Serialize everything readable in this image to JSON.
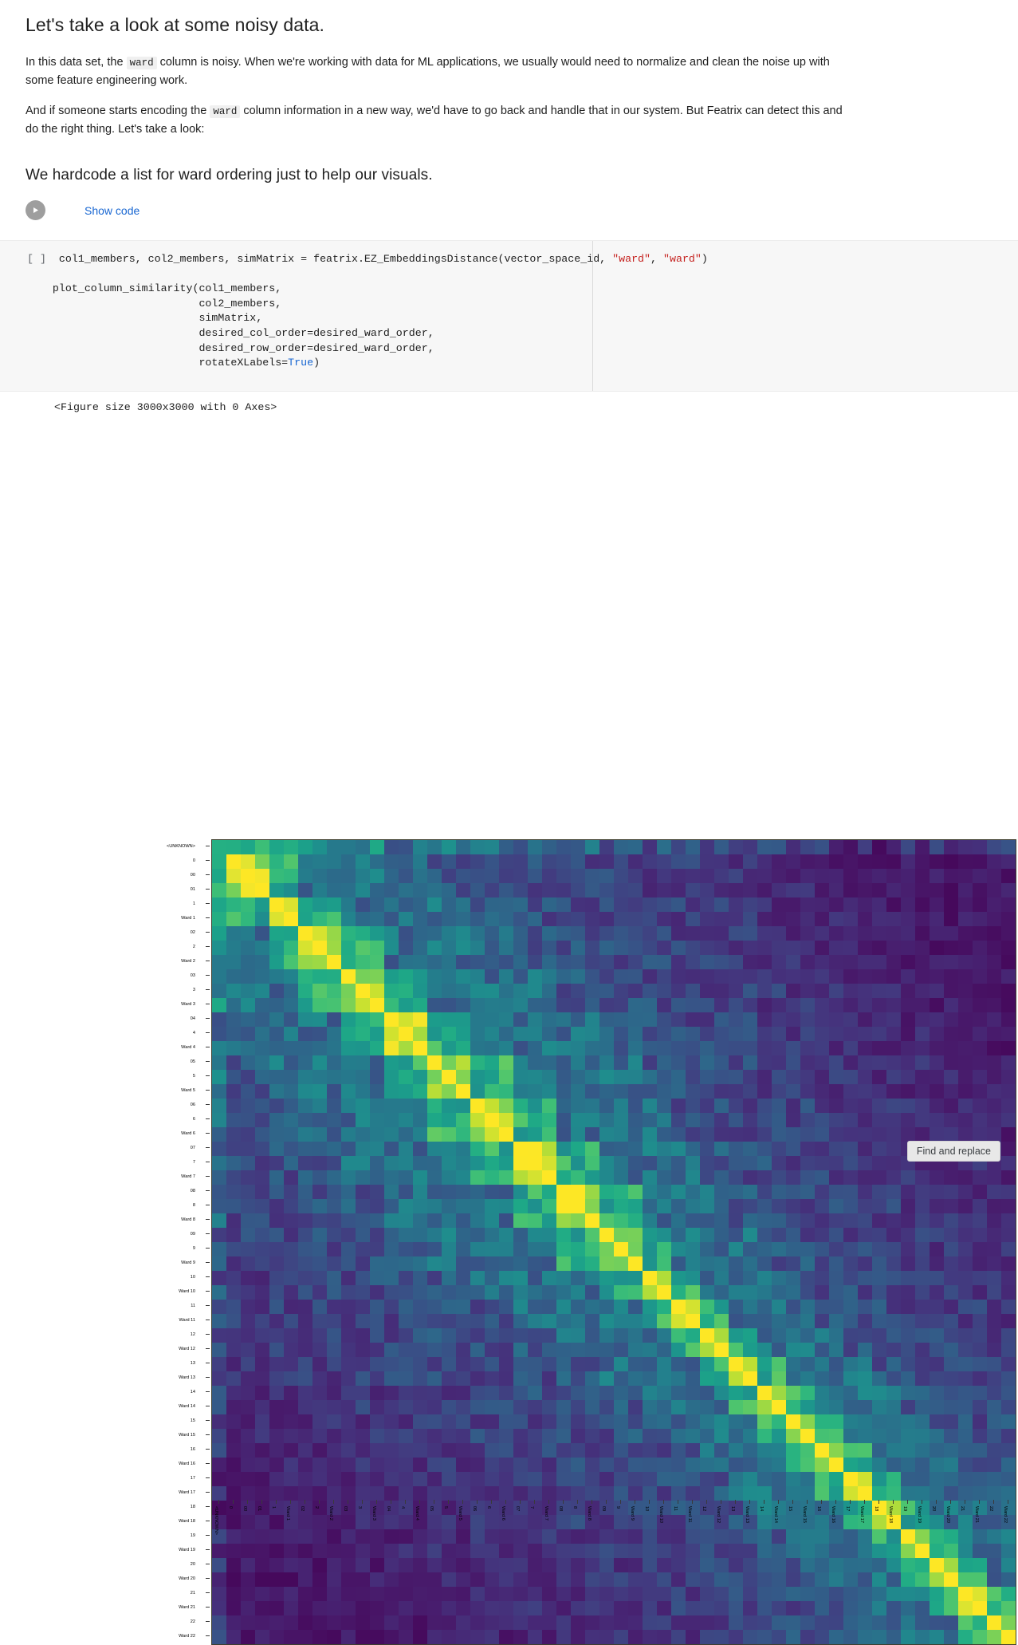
{
  "notebook": {
    "title": "Let's take a look at some noisy data.",
    "paragraph1_part1": "In this data set, the ",
    "paragraph1_code": "ward",
    "paragraph1_part2": " column is noisy. When we're working with data for ML applications, we usually would need to normalize and clean the noise up with some feature engineering work.",
    "paragraph2_part1": "And if someone starts encoding the ",
    "paragraph2_code": "ward",
    "paragraph2_part2": " column information in a new way, we'd have to go back and handle that in our system. But Featrix can detect this and do the right thing. Let's take a look:",
    "subtitle": "We hardcode a list for ward ordering just to help our visuals.",
    "show_code_label": "Show code",
    "play_icon": "play-icon"
  },
  "code_cell": {
    "prompt": "[ ]",
    "line1_pre": "col1_members, col2_members, simMatrix = featrix.EZ_EmbeddingsDistance(vector_space_id, ",
    "line1_str1": "\"ward\"",
    "line1_comma": ", ",
    "line1_str2": "\"ward\"",
    "line1_close": ")",
    "line2": "plot_column_similarity(col1_members,",
    "line3": "                       col2_members,",
    "line4": "                       simMatrix,",
    "line5": "                       desired_col_order=desired_ward_order,",
    "line6": "                       desired_row_order=desired_ward_order,",
    "line7_pre": "                       rotateXLabels=",
    "line7_kw": "True",
    "line7_close": ")"
  },
  "output": {
    "figure_text": "<Figure size 3000x3000 with 0 Axes>"
  },
  "toolbar": {
    "find_and_replace": "Find and replace"
  },
  "chart_data": {
    "type": "heatmap",
    "title": "",
    "xlabel": "",
    "ylabel": "",
    "colormap": "viridis",
    "vmin": 0,
    "vmax": 1,
    "grid": false,
    "legend": "none",
    "categories": [
      "<UNKNOWN>",
      "0",
      "00",
      "01",
      "1",
      "Ward 1",
      "02",
      "2",
      "Ward 2",
      "03",
      "3",
      "Ward 3",
      "04",
      "4",
      "Ward 4",
      "05",
      "5",
      "Ward 5",
      "06",
      "6",
      "Ward 6",
      "07",
      "7",
      "Ward 7",
      "08",
      "8",
      "Ward 8",
      "09",
      "9",
      "Ward 9",
      "10",
      "Ward 10",
      "11",
      "Ward 11",
      "12",
      "Ward 12",
      "13",
      "Ward 13",
      "14",
      "Ward 14",
      "15",
      "Ward 15",
      "16",
      "Ward 16",
      "17",
      "Ward 17",
      "18",
      "Ward 18",
      "19",
      "Ward 19",
      "20",
      "Ward 20",
      "21",
      "Ward 21",
      "22",
      "Ward 22"
    ],
    "x_tick_rotation": 90,
    "blocks": [
      {
        "label": "<UNKNOWN>",
        "start": 0,
        "end": 0
      },
      {
        "label": "ward-0",
        "start": 1,
        "end": 3
      },
      {
        "label": "ward-1",
        "start": 4,
        "end": 5
      },
      {
        "label": "ward-2",
        "start": 6,
        "end": 8
      },
      {
        "label": "ward-3",
        "start": 9,
        "end": 11
      },
      {
        "label": "ward-4",
        "start": 12,
        "end": 14
      },
      {
        "label": "ward-5",
        "start": 15,
        "end": 17
      },
      {
        "label": "ward-6",
        "start": 18,
        "end": 20
      },
      {
        "label": "ward-7",
        "start": 21,
        "end": 23
      },
      {
        "label": "ward-8",
        "start": 24,
        "end": 26
      },
      {
        "label": "ward-9",
        "start": 27,
        "end": 29
      },
      {
        "label": "ward-10",
        "start": 30,
        "end": 31
      },
      {
        "label": "ward-11",
        "start": 32,
        "end": 33
      },
      {
        "label": "ward-12",
        "start": 34,
        "end": 35
      },
      {
        "label": "ward-13",
        "start": 36,
        "end": 37
      },
      {
        "label": "ward-14",
        "start": 38,
        "end": 39
      },
      {
        "label": "ward-15",
        "start": 40,
        "end": 41
      },
      {
        "label": "ward-16",
        "start": 42,
        "end": 43
      },
      {
        "label": "ward-17",
        "start": 44,
        "end": 45
      },
      {
        "label": "ward-18",
        "start": 46,
        "end": 47
      },
      {
        "label": "ward-19",
        "start": 48,
        "end": 49
      },
      {
        "label": "ward-20",
        "start": 50,
        "end": 51
      },
      {
        "label": "ward-21",
        "start": 52,
        "end": 53
      },
      {
        "label": "ward-22",
        "start": 54,
        "end": 55
      }
    ],
    "value_ranges": {
      "diagonal_block": [
        0.8,
        1.0
      ],
      "near_block": [
        0.5,
        0.78
      ],
      "background": [
        0.25,
        0.5
      ],
      "distant": [
        0.05,
        0.28
      ]
    }
  }
}
